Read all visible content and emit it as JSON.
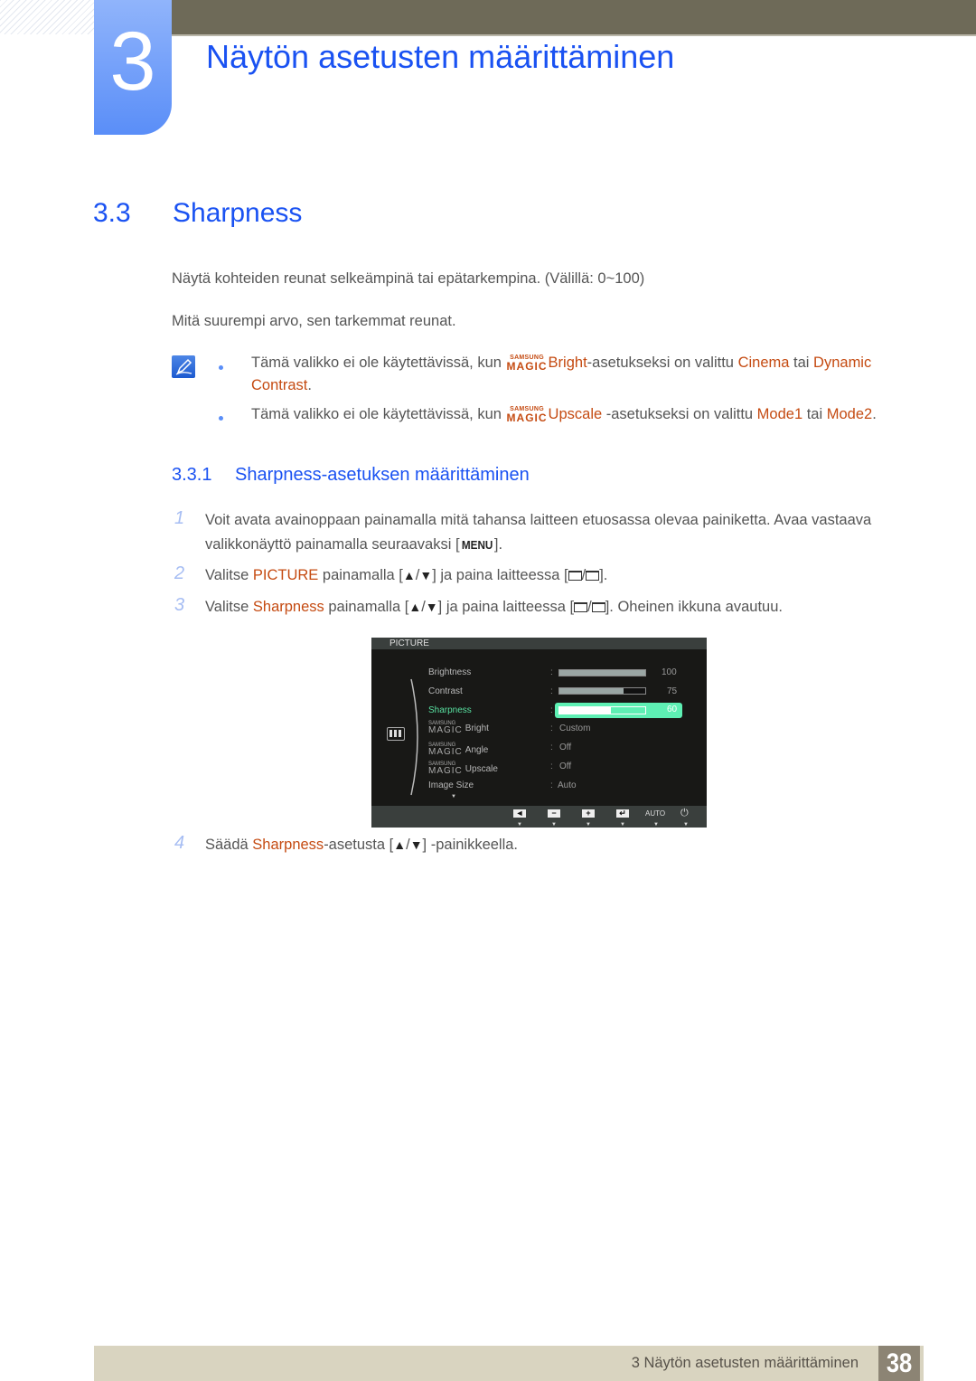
{
  "chapter": {
    "number": "3",
    "title": "Näytön asetusten määrittäminen"
  },
  "section": {
    "number": "3.3",
    "title": "Sharpness"
  },
  "intro": [
    "Näytä kohteiden reunat selkeämpinä tai epätarkempina. (Välillä: 0~100)",
    "Mitä suurempi arvo, sen tarkemmat reunat."
  ],
  "magic_logo": {
    "top": "SAMSUNG",
    "bottom": "MAGIC"
  },
  "notes": [
    {
      "pre": "Tämä valikko ei ole käytettävissä, kun ",
      "feature": "Bright",
      "mid": "-asetukseksi on valittu ",
      "opt1": "Cinema",
      "sep": " tai ",
      "opt2": "Dynamic",
      "opt2b": "Contrast",
      "end": "."
    },
    {
      "pre": "Tämä valikko ei ole käytettävissä, kun ",
      "feature": "Upscale",
      "mid": " -asetukseksi on valittu ",
      "opt1": "Mode1",
      "sep": " tai ",
      "opt2": "Mode2",
      "end": "."
    }
  ],
  "subsection": {
    "number": "3.3.1",
    "title": "Sharpness-asetuksen määrittäminen"
  },
  "steps": [
    {
      "num": "1",
      "line1": "Voit avata avainoppaan painamalla mitä tahansa laitteen etuosassa olevaa painiketta. Avaa vastaava",
      "line2_pre": "valikkonäyttö painamalla seuraavaksi [",
      "key": "MENU",
      "line2_post": "]."
    },
    {
      "num": "2",
      "pre": "Valitse ",
      "hl": "PICTURE",
      "mid": " painamalla [",
      "mid2": "] ja paina laitteessa [",
      "post": "]."
    },
    {
      "num": "3",
      "pre": "Valitse ",
      "hl": "Sharpness",
      "mid": " painamalla [",
      "mid2": "] ja paina laitteessa [",
      "post": "]. Oheinen ikkuna avautuu."
    },
    {
      "num": "4",
      "pre": "Säädä ",
      "hl": "Sharpness",
      "mid": "-asetusta [",
      "post": "] -painikkeella."
    }
  ],
  "glyphs": {
    "up": "▲",
    "down": "▼",
    "slash": "/"
  },
  "osd": {
    "title": "PICTURE",
    "items": [
      {
        "label": "Brightness",
        "type": "bar",
        "value": "100",
        "fraction": 1.0
      },
      {
        "label": "Contrast",
        "type": "bar",
        "value": "75",
        "fraction": 0.75
      },
      {
        "label": "Sharpness",
        "type": "bar",
        "value": "60",
        "fraction": 0.6,
        "selected": true
      },
      {
        "label": "Bright",
        "magic": true,
        "type": "text",
        "value": "Custom"
      },
      {
        "label": "Angle",
        "magic": true,
        "type": "text",
        "value": "Off"
      },
      {
        "label": "Upscale",
        "magic": true,
        "type": "text",
        "value": "Off"
      },
      {
        "label": "Image Size",
        "type": "text",
        "value": "Auto"
      }
    ],
    "colon": ":",
    "buttons": [
      "◄",
      "−",
      "+",
      "↵"
    ],
    "auto_label": "AUTO",
    "power": "⏻",
    "more": "▼",
    "tick": "▼"
  },
  "footer": {
    "text": "3 Näytön asetusten määrittäminen",
    "page": "38"
  }
}
